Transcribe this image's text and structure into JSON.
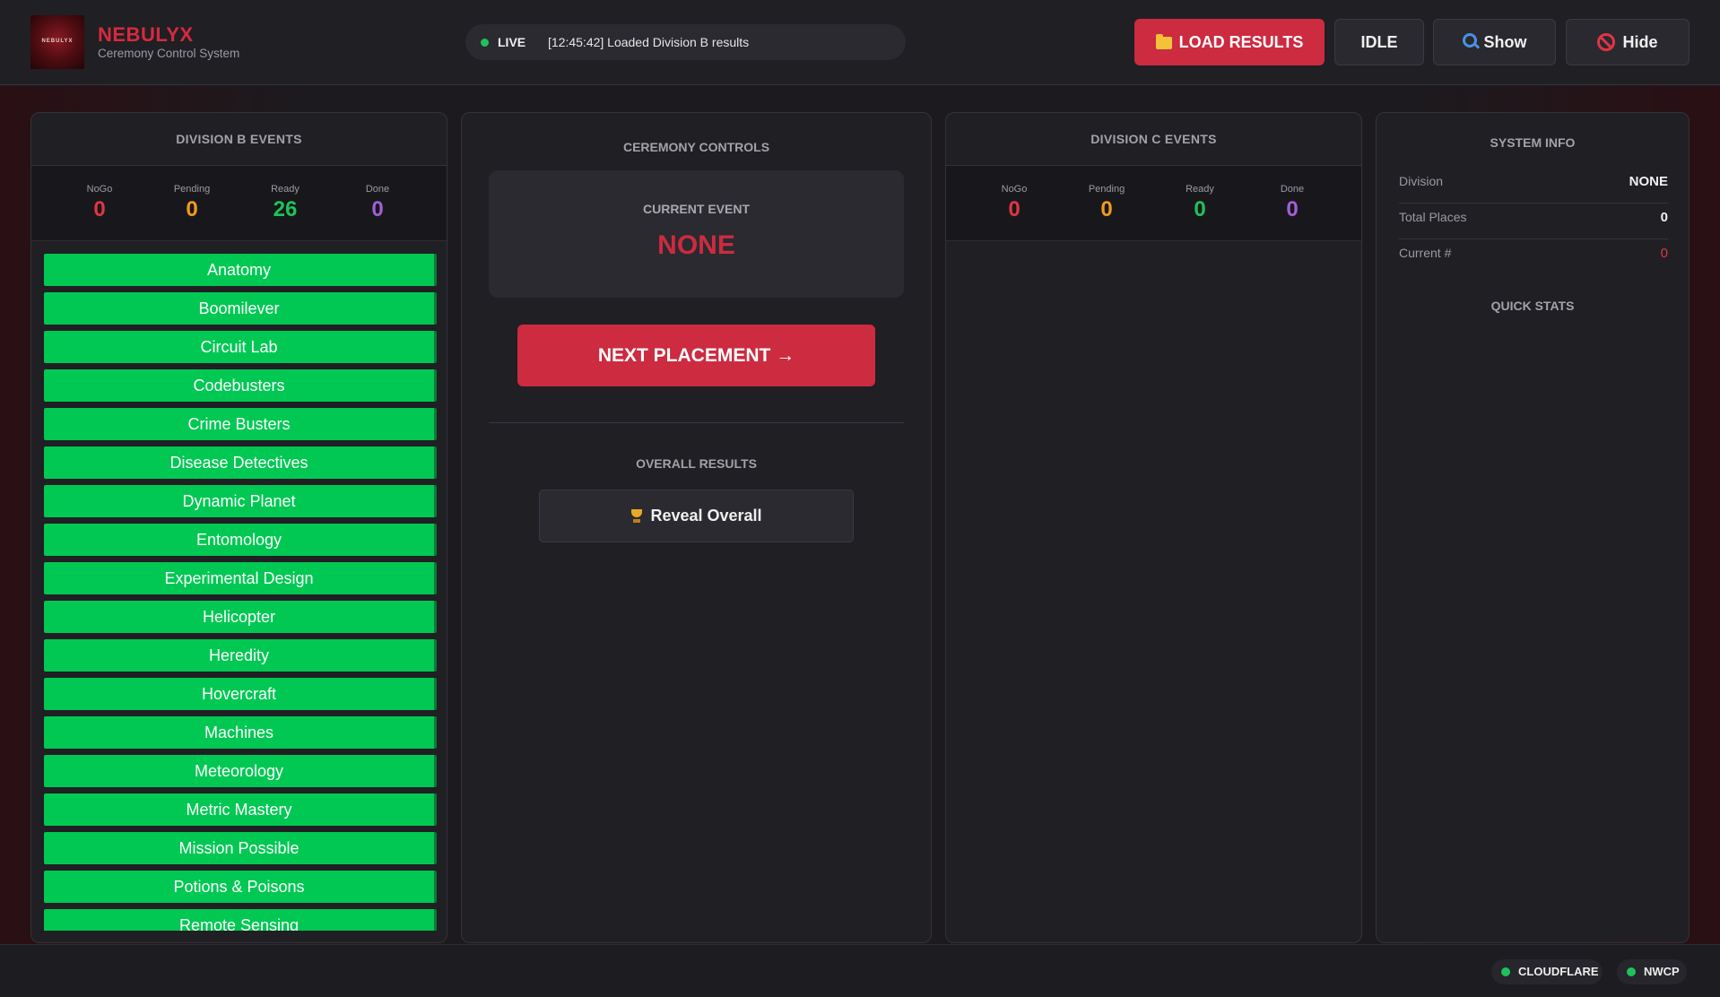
{
  "header": {
    "logo_text": "NEBULYX",
    "brand_name": "NEBULYX",
    "brand_subtitle": "Ceremony Control System",
    "live_label": "LIVE",
    "status_message": "[12:45:42] Loaded Division B results",
    "buttons": {
      "load": "LOAD RESULTS",
      "idle": "IDLE",
      "show": "Show",
      "hide": "Hide"
    }
  },
  "division_b": {
    "title": "DIVISION B EVENTS",
    "counts": [
      {
        "label": "NoGo",
        "value": "0"
      },
      {
        "label": "Pending",
        "value": "0"
      },
      {
        "label": "Ready",
        "value": "26"
      },
      {
        "label": "Done",
        "value": "0"
      }
    ],
    "events": [
      "Anatomy",
      "Boomilever",
      "Circuit Lab",
      "Codebusters",
      "Crime Busters",
      "Disease Detectives",
      "Dynamic Planet",
      "Entomology",
      "Experimental Design",
      "Helicopter",
      "Heredity",
      "Hovercraft",
      "Machines",
      "Meteorology",
      "Metric Mastery",
      "Mission Possible",
      "Potions & Poisons",
      "Remote Sensing"
    ]
  },
  "controls": {
    "title": "CEREMONY CONTROLS",
    "current_event_label": "CURRENT EVENT",
    "current_event_value": "NONE",
    "next_button": "NEXT PLACEMENT →",
    "overall_title": "OVERALL RESULTS",
    "reveal_button": "Reveal Overall"
  },
  "division_c": {
    "title": "DIVISION C EVENTS",
    "counts": [
      {
        "label": "NoGo",
        "value": "0"
      },
      {
        "label": "Pending",
        "value": "0"
      },
      {
        "label": "Ready",
        "value": "0"
      },
      {
        "label": "Done",
        "value": "0"
      }
    ]
  },
  "system_info": {
    "title": "SYSTEM INFO",
    "rows": [
      {
        "key": "Division",
        "value": "NONE"
      },
      {
        "key": "Total Places",
        "value": "0"
      },
      {
        "key": "Current #",
        "value": "0"
      }
    ],
    "quick_stats_title": "QUICK STATS"
  },
  "footer": {
    "services": [
      "CLOUDFLARE",
      "NWCP"
    ]
  },
  "colors": {
    "accent": "#cc2b40",
    "ready": "#00c853",
    "nogo": "#e03545",
    "pending": "#f39a1e",
    "done": "#a35fd6"
  }
}
